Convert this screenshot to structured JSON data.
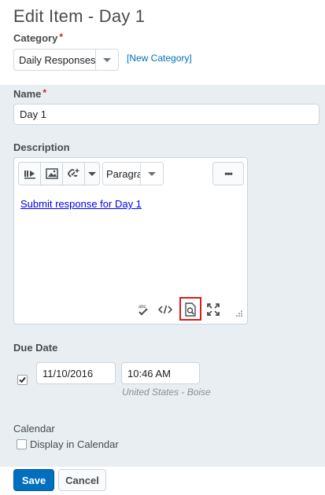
{
  "title": "Edit Item - Day 1",
  "category": {
    "label": "Category",
    "required_mark": "*",
    "selected": "Daily Responses",
    "new_link": "[New Category]"
  },
  "name": {
    "label": "Name",
    "required_mark": "*",
    "value": "Day 1"
  },
  "description": {
    "label": "Description",
    "toolbar": {
      "format_selected": "Paragra",
      "more_label": "•••",
      "icons": [
        "insert-stuff-icon",
        "insert-image-icon",
        "insert-quicklink-icon",
        "dropdown-chevron-icon"
      ]
    },
    "content_link": "Submit response for Day 1",
    "bottom_icons": [
      "spellcheck-icon",
      "source-code-icon",
      "preview-icon",
      "fullscreen-icon",
      "resize-grip-icon"
    ],
    "spellcheck_text": "abc"
  },
  "due_date": {
    "label": "Due Date",
    "checked": true,
    "date": "11/10/2016",
    "time": "10:46 AM",
    "timezone": "United States - Boise"
  },
  "calendar": {
    "label": "Calendar",
    "checkbox_label": "Display in Calendar",
    "checked": false
  },
  "buttons": {
    "save": "Save",
    "cancel": "Cancel"
  },
  "colors": {
    "accent": "#006fbf",
    "panel_bg": "#e8eef1",
    "required": "#cd2026",
    "highlight": "#e01a1a"
  }
}
